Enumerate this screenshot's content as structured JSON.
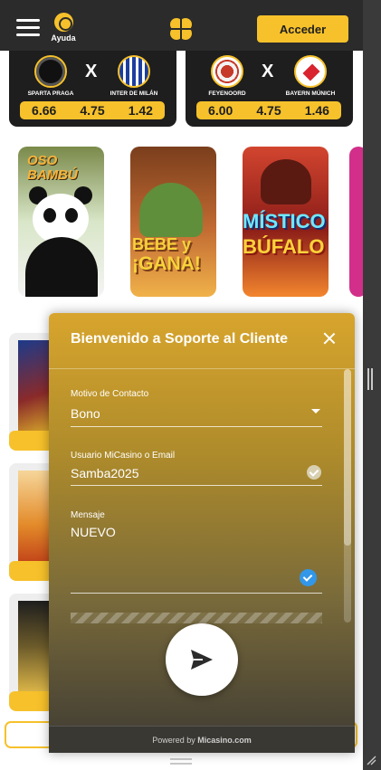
{
  "header": {
    "help_label": "Ayuda",
    "login_label": "Acceder",
    "accent_color": "#f6c12b"
  },
  "matches": [
    {
      "home": "SPARTA PRAGA",
      "away": "INTER DE MILÁN",
      "separator": "X",
      "odds": [
        "6.66",
        "4.75",
        "1.42"
      ]
    },
    {
      "home": "FEYENOORD",
      "away": "BAYERN MÚNICH",
      "separator": "X",
      "odds": [
        "6.00",
        "4.75",
        "1.46"
      ]
    }
  ],
  "games": [
    {
      "lines": [
        "OSO",
        "BAMBÚ"
      ]
    },
    {
      "lines": [
        "BEBE y",
        "¡GANA!"
      ]
    },
    {
      "lines": [
        "MÍSTICO",
        "BÚFALO"
      ]
    }
  ],
  "support": {
    "title": "Bienvenido a Soporte al Cliente",
    "reason_label": "Motivo de Contacto",
    "reason_value": "Bono",
    "user_label": "Usuario MiCasino o Email",
    "user_value": "Samba2025",
    "message_label": "Mensaje",
    "message_value": "NUEVO",
    "powered_prefix": "Powered by ",
    "powered_brand": "Micasino.com"
  },
  "icons": [
    "hamburger-icon",
    "help-icon",
    "clover-logo-icon",
    "close-icon",
    "chevron-down-icon",
    "check-icon",
    "send-icon",
    "resize-icon"
  ]
}
